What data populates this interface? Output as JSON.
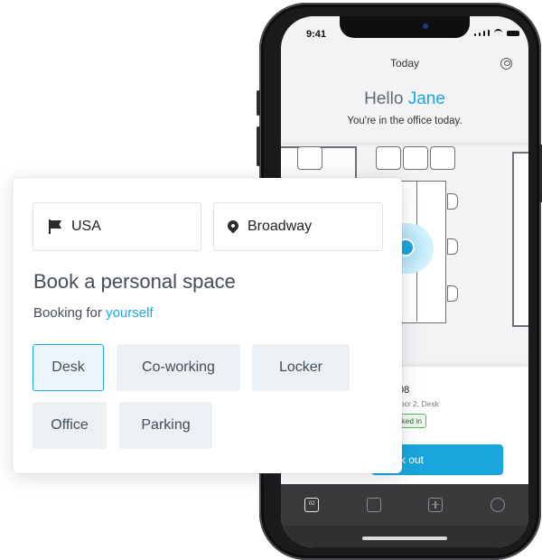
{
  "phone": {
    "status_time": "9:41",
    "nav_title": "Today",
    "greeting_prefix": "Hello",
    "greeting_name": "Jane",
    "greeting_sub": "You're in the office today.",
    "booking_card": {
      "code_partial": "08",
      "detail_partial": "locr 2, Desk",
      "badge_partial": "cked in",
      "button_partial": "k out"
    },
    "tabs": [
      {
        "icon": "calendar-today-icon",
        "label": "02",
        "active": true
      },
      {
        "icon": "calendar-icon",
        "active": false
      },
      {
        "icon": "plus-square-icon",
        "active": false
      },
      {
        "icon": "search-icon",
        "active": false
      }
    ],
    "colors": {
      "accent": "#1ba8de",
      "checked_in": "#56b55a"
    }
  },
  "booking": {
    "country": {
      "icon": "flag-icon",
      "value": "USA"
    },
    "location": {
      "icon": "location-pin-icon",
      "value": "Broadway"
    },
    "title": "Book a personal space",
    "subtitle_prefix": "Booking for",
    "subtitle_target": "yourself",
    "space_types": [
      {
        "label": "Desk",
        "selected": true
      },
      {
        "label": "Co-working",
        "selected": false
      },
      {
        "label": "Locker",
        "selected": false
      },
      {
        "label": "Office",
        "selected": false
      },
      {
        "label": "Parking",
        "selected": false
      }
    ]
  }
}
